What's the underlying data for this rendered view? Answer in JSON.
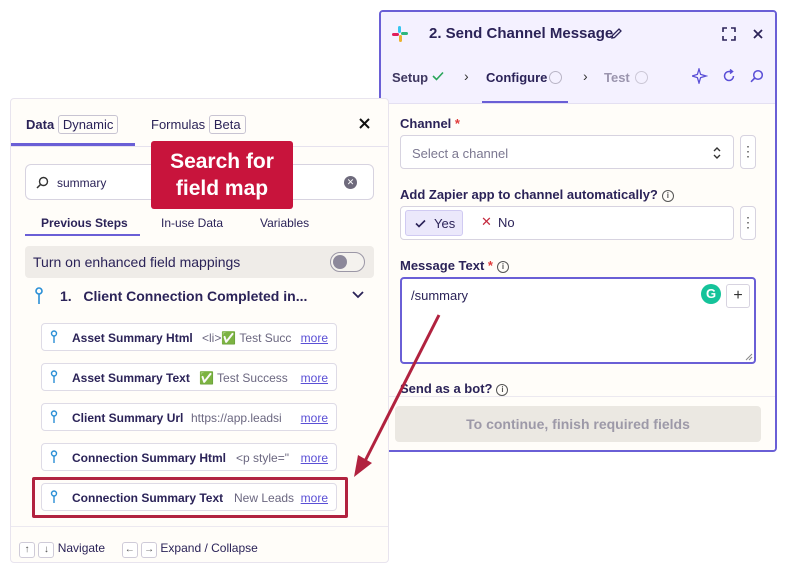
{
  "step": {
    "title": "2. Send Channel Message",
    "tabs": [
      {
        "label": "Setup"
      },
      {
        "label": "Configure"
      },
      {
        "label": "Test"
      }
    ],
    "channel": {
      "label": "Channel",
      "required_mark": "*",
      "placeholder": "Select a channel"
    },
    "add_app": {
      "label": "Add Zapier app to channel automatically?",
      "yes": "Yes",
      "no": "No"
    },
    "message": {
      "label": "Message Text",
      "required_mark": "*",
      "value": "/summary"
    },
    "bot": {
      "label": "Send as a bot?"
    },
    "continue_label": "To continue, finish required fields"
  },
  "data_panel": {
    "tabs": [
      {
        "label": "Data",
        "badge": "Dynamic"
      },
      {
        "label": "Formulas",
        "badge": "Beta"
      }
    ],
    "search_value": "summary",
    "subtabs": [
      "Previous Steps",
      "In-use Data",
      "Variables"
    ],
    "toggle_label": "Turn on enhanced field mappings",
    "step_group": {
      "number": "1.",
      "title": "Client Connection Completed in..."
    },
    "items": [
      {
        "name": "Asset Summary Html",
        "value": "<li>✅ Test Succ",
        "more": "more"
      },
      {
        "name": "Asset Summary Text",
        "value": "✅ Test Success",
        "more": "more"
      },
      {
        "name": "Client Summary Url",
        "value": "https://app.leadsi",
        "more": "more"
      },
      {
        "name": "Connection Summary Html",
        "value": "<p style=\"",
        "more": "more"
      },
      {
        "name": "Connection Summary Text",
        "value": "New Leads",
        "more": "more"
      }
    ],
    "footer": {
      "navigate": "Navigate",
      "expand": "Expand / Collapse",
      "up": "↑",
      "down": "↓",
      "left": "←",
      "right": "→"
    }
  },
  "callout": {
    "line1": "Search for",
    "line2": "field map"
  },
  "colors": {
    "accent": "#6a5fd6",
    "callout": "#c8143c",
    "highlight": "#b1223f"
  }
}
